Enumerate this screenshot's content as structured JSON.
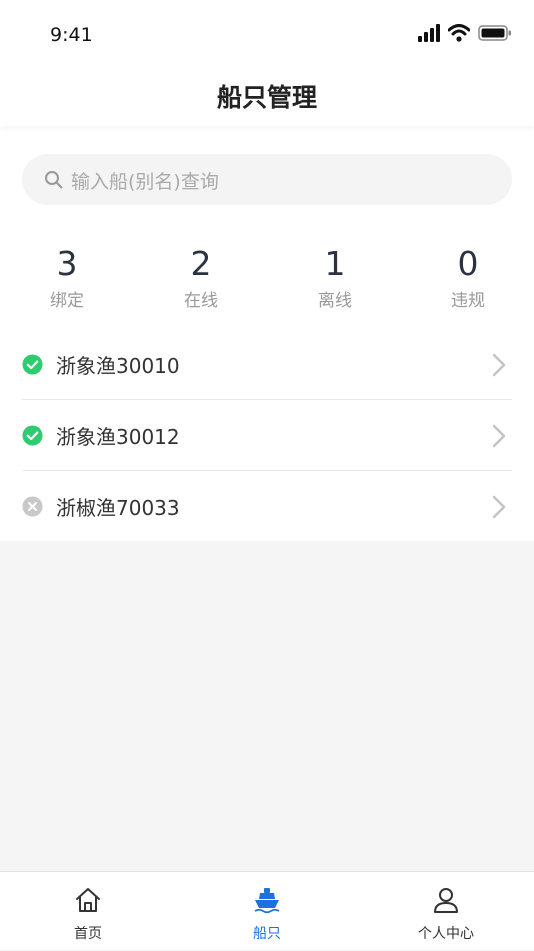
{
  "status_bar": {
    "time": "9:41"
  },
  "header": {
    "title": "船只管理"
  },
  "search": {
    "placeholder": "输入船(别名)查询"
  },
  "stats": [
    {
      "value": "3",
      "label": "绑定"
    },
    {
      "value": "2",
      "label": "在线"
    },
    {
      "value": "1",
      "label": "离线"
    },
    {
      "value": "0",
      "label": "违规"
    }
  ],
  "ships": [
    {
      "name": "浙象渔30010",
      "status": "online",
      "status_icon": "check-circle-icon"
    },
    {
      "name": "浙象渔30012",
      "status": "online",
      "status_icon": "check-circle-icon"
    },
    {
      "name": "浙椒渔70033",
      "status": "offline",
      "status_icon": "x-circle-icon"
    }
  ],
  "tabbar": {
    "items": [
      {
        "label": "首页",
        "icon": "home-icon",
        "active": false
      },
      {
        "label": "船只",
        "icon": "ship-icon",
        "active": true
      },
      {
        "label": "个人中心",
        "icon": "user-icon",
        "active": false
      }
    ]
  },
  "colors": {
    "online": "#2ecc71",
    "offline": "#c8c8c8",
    "accent": "#1f6fe0",
    "background": "#f5f5f5"
  }
}
